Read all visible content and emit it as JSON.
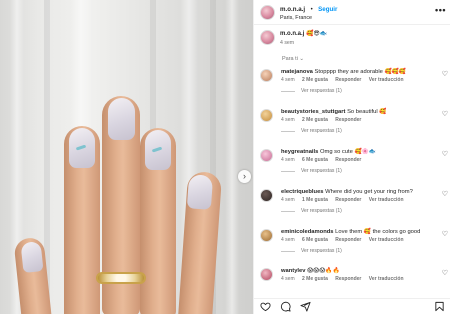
{
  "post": {
    "username": "m.o.n.a.j",
    "follow_label": "Seguir",
    "location": "Paris, France",
    "caption_emojis": "🥰😎🐟",
    "caption_time": "4 sem",
    "sort_label": "Para ti ⌄"
  },
  "comments": [
    {
      "user": "matejanova",
      "text": "Stopppp they are adorable 🥰🥰🥰",
      "time": "4 sem",
      "likes": "2 Me gusta",
      "reply": "Responder",
      "translate": "Ver traducción",
      "replies": "Ver respuestas (1)"
    },
    {
      "user": "beautystories_stuttgart",
      "text": "So beautiful 🥰",
      "time": "4 sem",
      "likes": "2 Me gusta",
      "reply": "Responder",
      "translate": "",
      "replies": "Ver respuestas (1)"
    },
    {
      "user": "heygreatnails",
      "text": "Omg so cute 🥰🌸🐟",
      "time": "4 sem",
      "likes": "6 Me gusta",
      "reply": "Responder",
      "translate": "",
      "replies": "Ver respuestas (1)"
    },
    {
      "user": "electriqueblues",
      "text": "Where did you get your ring from?",
      "time": "4 sem",
      "likes": "1 Me gusta",
      "reply": "Responder",
      "translate": "Ver traducción",
      "replies": "Ver respuestas (1)"
    },
    {
      "user": "eminicoledamonds",
      "text": "Love them 🥰 the colors go good",
      "time": "4 sem",
      "likes": "6 Me gusta",
      "reply": "Responder",
      "translate": "Ver traducción",
      "replies": "Ver respuestas (1)"
    },
    {
      "user": "wantylev",
      "text": "😱😱😱🔥🔥",
      "time": "4 sem",
      "likes": "2 Me gusta",
      "reply": "Responder",
      "translate": "Ver traducción",
      "replies": ""
    }
  ],
  "icons": {
    "more": "more-options-icon",
    "like": "heart-outline-icon",
    "comment": "comment-bubble-icon",
    "share": "paper-plane-icon",
    "save": "bookmark-icon",
    "carousel": "chevron-right-icon"
  },
  "colors": {
    "link": "#0095f6",
    "meta": "#737373",
    "text": "#262626"
  }
}
